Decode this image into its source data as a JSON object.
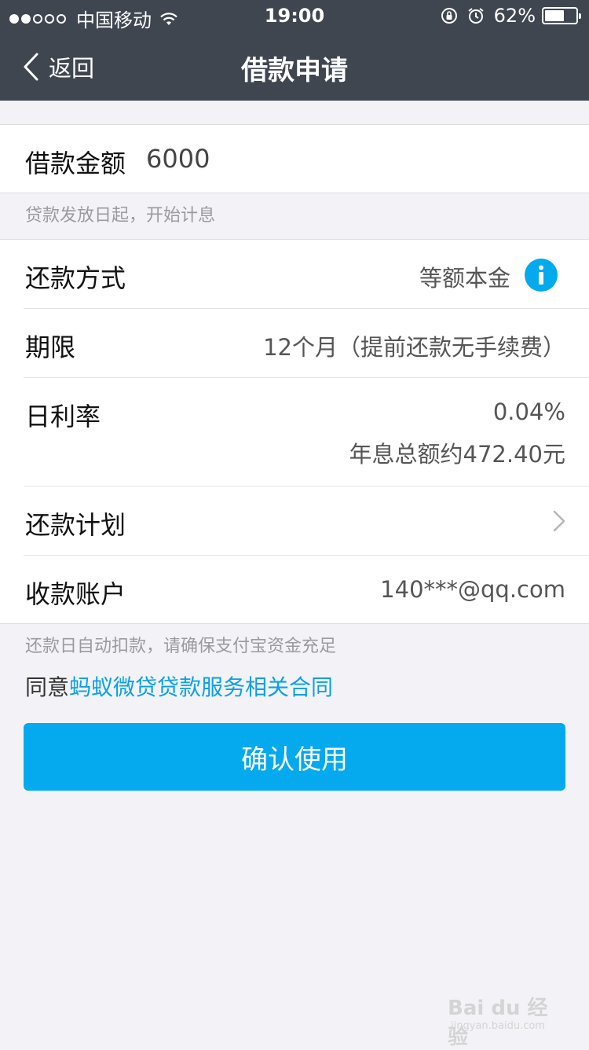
{
  "status_bar": {
    "carrier": "中国移动",
    "time": "19:00",
    "battery_percent": "62%",
    "battery_level": 0.62,
    "signal_bars": 2,
    "icons": [
      "wifi-icon",
      "orientation-lock-icon",
      "alarm-icon",
      "battery-icon"
    ]
  },
  "nav": {
    "back_label": "返回",
    "title": "借款申请"
  },
  "loan_amount": {
    "label": "借款金额",
    "value": "6000"
  },
  "hint_interest": "贷款发放日起，开始计息",
  "details": {
    "repayment_method": {
      "label": "还款方式",
      "value": "等额本金",
      "icon": "info-icon"
    },
    "term": {
      "label": "期限",
      "value": "12个月（提前还款无手续费）"
    },
    "daily_rate": {
      "label": "日利率",
      "value": "0.04%",
      "sub_value": "年息总额约472.40元"
    },
    "repayment_plan": {
      "label": "还款计划",
      "icon": "chevron-right-icon"
    },
    "receiving_account": {
      "label": "收款账户",
      "value": "140***@qq.com"
    }
  },
  "hint_autodebit": "还款日自动扣款，请确保支付宝资金充足",
  "agreement": {
    "prefix": "同意",
    "link": "蚂蚁微贷贷款服务相关合同"
  },
  "confirm_button": "确认使用",
  "watermark": {
    "main": "Bai du 经验",
    "sub": "jingyan.baidu.com"
  },
  "colors": {
    "nav_bg": "#3f4650",
    "accent": "#04a9ee",
    "link": "#0aa0e9",
    "page_bg": "#f3f3f7"
  }
}
